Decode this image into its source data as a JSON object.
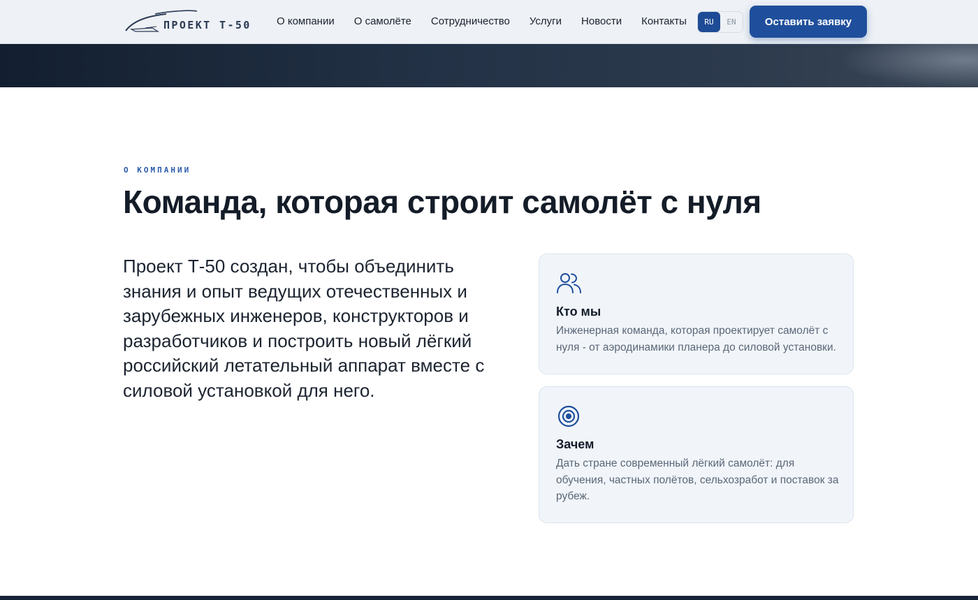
{
  "header": {
    "logo_text": "ПРОЕКТ Т-50",
    "nav": [
      "О компании",
      "О самолёте",
      "Сотрудничество",
      "Услуги",
      "Новости",
      "Контакты"
    ],
    "lang": {
      "ru": "RU",
      "en": "EN",
      "active": "RU"
    },
    "cta_label": "Оставить заявку"
  },
  "about": {
    "eyebrow": "О КОМПАНИИ",
    "title": "Команда, которая строит самолёт с нуля",
    "lead": "Проект Т-50 создан, чтобы объединить знания и опыт ведущих отечественных и зарубежных инженеров, конструкторов и разработчиков и построить новый лёгкий российский летательный аппарат вместе с силовой установкой для него.",
    "cards": [
      {
        "icon": "users-icon",
        "title": "Кто мы",
        "text": "Инженерная команда, которая проектирует самолёт с нуля - от аэродинамики планера до силовой установки."
      },
      {
        "icon": "target-icon",
        "title": "Зачем",
        "text": "Дать стране современный лёгкий самолёт: для обучения, частных полётов, сельхозработ и поставок за рубеж."
      }
    ]
  },
  "colors": {
    "accent": "#1f4f9c",
    "title": "#141c28",
    "muted": "#5b6677",
    "card_bg": "#f1f5fa"
  }
}
